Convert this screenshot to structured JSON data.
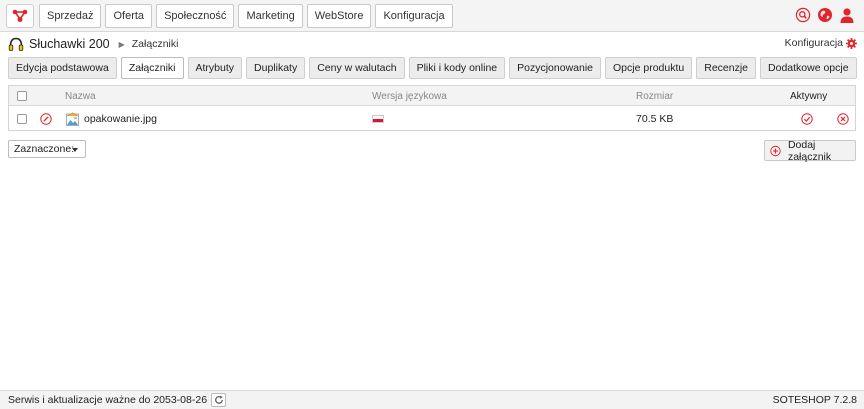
{
  "topbar": {
    "logo_icon": "soteshop-logo-icon",
    "menu": [
      "Sprzedaż",
      "Oferta",
      "Społeczność",
      "Marketing",
      "WebStore",
      "Konfiguracja"
    ],
    "icons": [
      "search-icon",
      "globe-icon",
      "user-icon"
    ],
    "accent_color": "#e0252c"
  },
  "breadcrumb": {
    "product_icon": "headphones-icon",
    "product": "Słuchawki 200",
    "current": "Załączniki"
  },
  "config_link": {
    "label": "Konfiguracja",
    "icon": "gear-icon"
  },
  "tabs": [
    {
      "label": "Edycja podstawowa",
      "active": false
    },
    {
      "label": "Załączniki",
      "active": true
    },
    {
      "label": "Atrybuty",
      "active": false
    },
    {
      "label": "Duplikaty",
      "active": false
    },
    {
      "label": "Ceny w walutach",
      "active": false
    },
    {
      "label": "Pliki i kody online",
      "active": false
    },
    {
      "label": "Pozycjonowanie",
      "active": false
    },
    {
      "label": "Opcje produktu",
      "active": false
    },
    {
      "label": "Recenzje",
      "active": false
    },
    {
      "label": "Dodatkowe opcje",
      "active": false
    }
  ],
  "table": {
    "headers": {
      "name": "Nazwa",
      "language": "Wersja językowa",
      "size": "Rozmiar",
      "active": "Aktywny"
    },
    "rows": [
      {
        "edit_icon": "edit-icon",
        "file_icon": "image-file-icon",
        "name": "opakowanie.jpg",
        "flag": "pl-flag-icon",
        "size": "70.5 KB",
        "active_icon": "check-circle-icon",
        "delete_icon": "delete-icon"
      }
    ]
  },
  "bulk": {
    "label": "Zaznaczone:"
  },
  "add_button": {
    "label": "Dodaj załącznik",
    "icon": "add-circle-icon"
  },
  "footer": {
    "service_text": "Serwis i aktualizacje ważne do 2053-08-26",
    "refresh_icon": "refresh-icon",
    "version": "SOTESHOP 7.2.8"
  }
}
